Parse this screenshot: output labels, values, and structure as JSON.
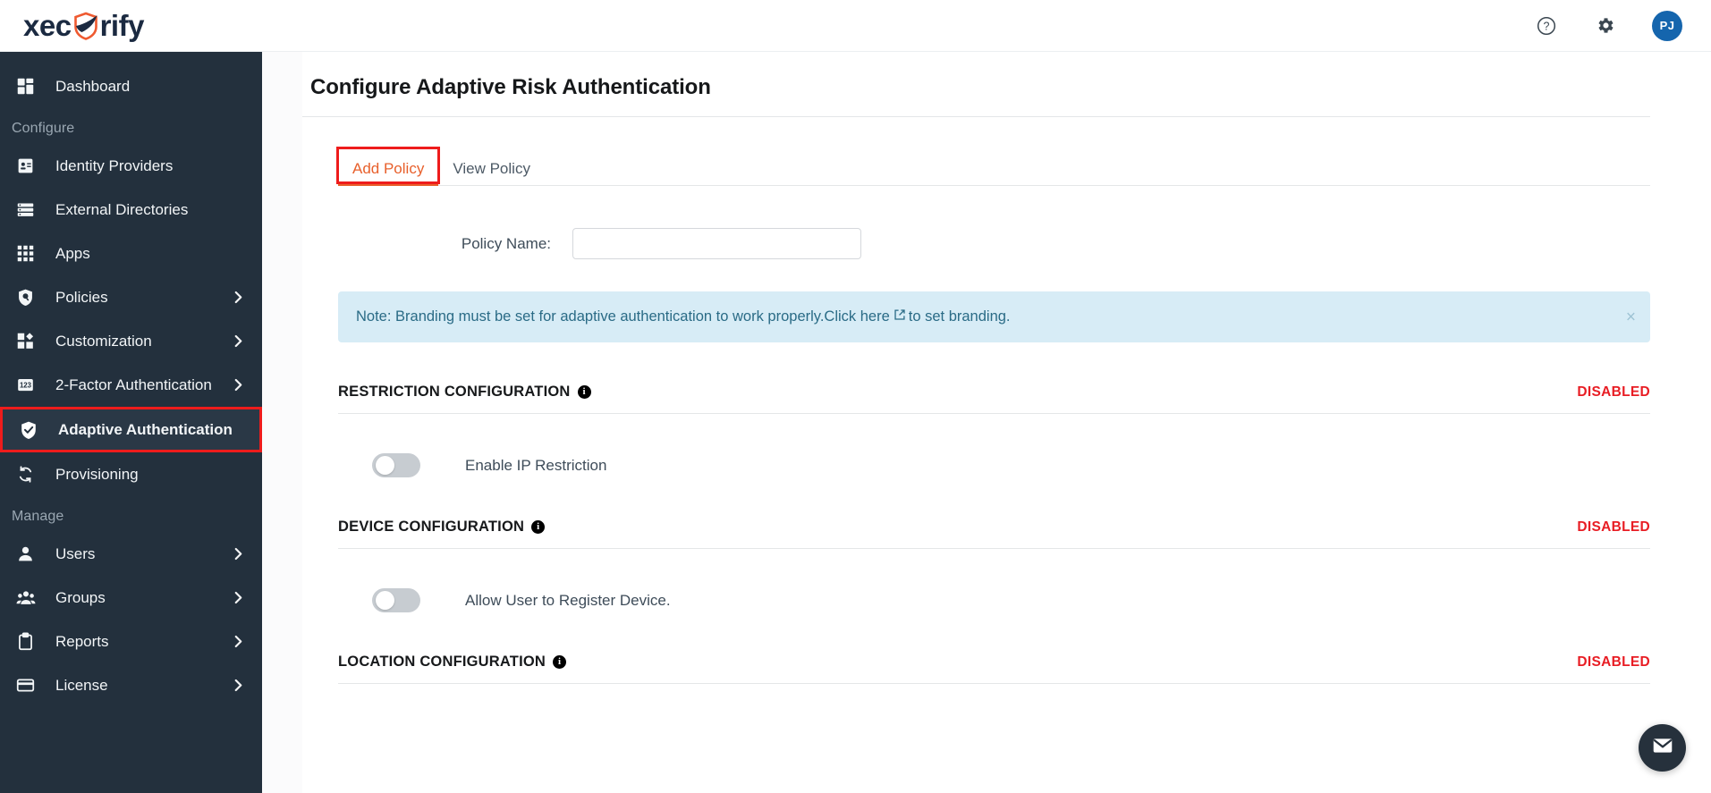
{
  "brand": {
    "name_part1": "xec",
    "name_part2": "rify",
    "shield_icon": "shield-icon"
  },
  "topbar": {
    "help_icon": "help-circle-icon",
    "settings_icon": "gear-icon",
    "avatar_initials": "PJ"
  },
  "sidebar": {
    "items": [
      {
        "label": "Dashboard",
        "icon": "dashboard-grid-icon",
        "type": "item",
        "chevron": false,
        "active": false
      },
      {
        "label": "Configure",
        "type": "section"
      },
      {
        "label": "Identity Providers",
        "icon": "id-card-icon",
        "type": "item",
        "chevron": false,
        "active": false
      },
      {
        "label": "External Directories",
        "icon": "server-list-icon",
        "type": "item",
        "chevron": false,
        "active": false
      },
      {
        "label": "Apps",
        "icon": "apps-grid-icon",
        "type": "item",
        "chevron": false,
        "active": false
      },
      {
        "label": "Policies",
        "icon": "policy-shield-search-icon",
        "type": "item",
        "chevron": true,
        "active": false
      },
      {
        "label": "Customization",
        "icon": "customization-puzzle-icon",
        "type": "item",
        "chevron": true,
        "active": false
      },
      {
        "label": "2-Factor Authentication",
        "icon": "numeric-123-icon",
        "type": "item",
        "chevron": true,
        "active": false
      },
      {
        "label": "Adaptive Authentication",
        "icon": "shield-check-icon",
        "type": "item",
        "chevron": false,
        "active": true
      },
      {
        "label": "Provisioning",
        "icon": "sync-arrows-icon",
        "type": "item",
        "chevron": false,
        "active": false
      },
      {
        "label": "Manage",
        "type": "section"
      },
      {
        "label": "Users",
        "icon": "user-icon",
        "type": "item",
        "chevron": true,
        "active": false
      },
      {
        "label": "Groups",
        "icon": "users-group-icon",
        "type": "item",
        "chevron": true,
        "active": false
      },
      {
        "label": "Reports",
        "icon": "clipboard-icon",
        "type": "item",
        "chevron": true,
        "active": false
      },
      {
        "label": "License",
        "icon": "credit-card-icon",
        "type": "item",
        "chevron": true,
        "active": false
      }
    ]
  },
  "main": {
    "page_title": "Configure Adaptive Risk Authentication",
    "tabs": [
      {
        "label": "Add Policy",
        "active": true
      },
      {
        "label": "View Policy",
        "active": false
      }
    ],
    "policy_name": {
      "label": "Policy Name:",
      "value": "",
      "placeholder": ""
    },
    "note": {
      "text_before": "Note: Branding must be set for adaptive authentication to work properly. ",
      "link_text": "Click here",
      "external_link_icon": "external-link-icon",
      "text_after": " to set branding.",
      "close_label": "×"
    },
    "sections": [
      {
        "title": "RESTRICTION CONFIGURATION",
        "info_icon": "info-icon",
        "status": "DISABLED",
        "toggle": {
          "label": "Enable IP Restriction",
          "on": false
        }
      },
      {
        "title": "DEVICE CONFIGURATION",
        "info_icon": "info-icon",
        "status": "DISABLED",
        "toggle": {
          "label": "Allow User to Register Device.",
          "on": false
        }
      },
      {
        "title": "LOCATION CONFIGURATION",
        "info_icon": "info-icon",
        "status": "DISABLED",
        "toggle": null
      }
    ]
  },
  "chat": {
    "icon": "email-envelope-icon"
  },
  "colors": {
    "sidebar_bg": "#23303d",
    "accent_orange": "#e8602c",
    "highlight_red": "#ee1c1c",
    "status_red": "#e81d24",
    "note_bg": "#d7ecf6",
    "note_text": "#2a6b86",
    "avatar_bg": "#1565ad"
  }
}
